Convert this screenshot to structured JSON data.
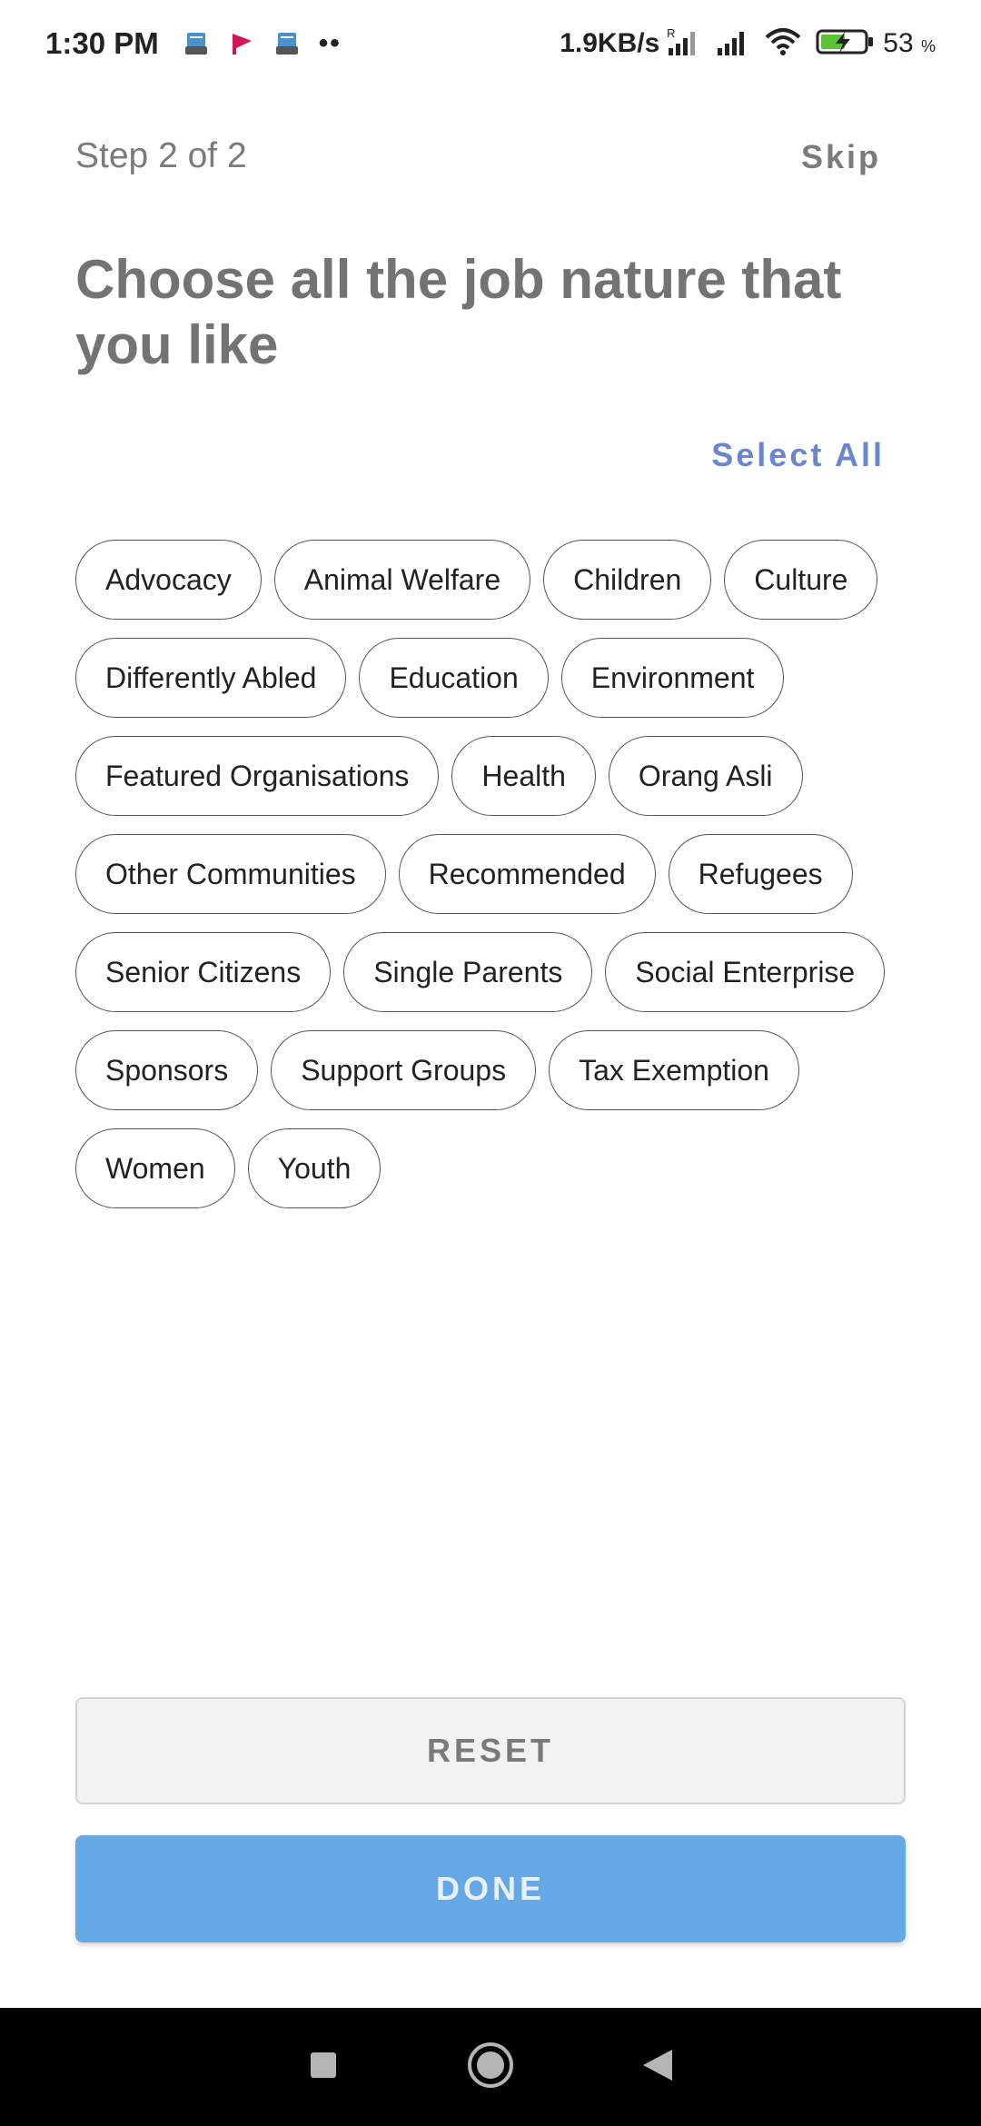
{
  "status_bar": {
    "time": "1:30 PM",
    "more_indicator": "••",
    "net_speed": "1.9KB/s",
    "battery_percent": "53",
    "battery_unit": "%"
  },
  "header": {
    "step": "Step 2 of 2",
    "skip_label": "Skip"
  },
  "title": "Choose all the job nature that you like",
  "select_all_label": "Select All",
  "chips": [
    "Advocacy",
    "Animal Welfare",
    "Children",
    "Culture",
    "Differently Abled",
    "Education",
    "Environment",
    "Featured Organisations",
    "Health",
    "Orang Asli",
    "Other Communities",
    "Recommended",
    "Refugees",
    "Senior Citizens",
    "Single Parents",
    "Social Enterprise",
    "Sponsors",
    "Support Groups",
    "Tax Exemption",
    "Women",
    "Youth"
  ],
  "actions": {
    "reset_label": "RESET",
    "done_label": "DONE"
  },
  "colors": {
    "accent": "#6b86d1",
    "done_button": "#66a8e6",
    "title_text": "#737373"
  }
}
